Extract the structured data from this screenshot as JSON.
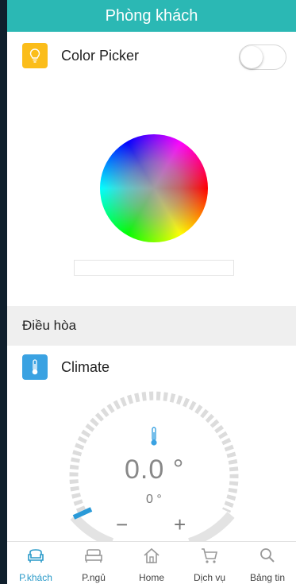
{
  "header": {
    "title": "Phòng khách"
  },
  "color_picker": {
    "label": "Color Picker",
    "icon": "lightbulb-icon",
    "toggle_on": false,
    "accent": "#fbbd1a"
  },
  "section": {
    "title": "Điều hòa"
  },
  "climate": {
    "label": "Climate",
    "icon": "thermometer-icon",
    "accent": "#3aa2e2",
    "temperature": "0.0 °",
    "secondary_temperature": "0 °",
    "minus": "−",
    "plus": "+"
  },
  "tabs": [
    {
      "label": "P.khách",
      "icon": "sofa-icon",
      "active": true
    },
    {
      "label": "P.ngủ",
      "icon": "bed-icon",
      "active": false
    },
    {
      "label": "Home",
      "icon": "home-icon",
      "active": false
    },
    {
      "label": "Dịch vụ",
      "icon": "cart-icon",
      "active": false
    },
    {
      "label": "Bảng tin",
      "icon": "search-icon",
      "active": false
    }
  ],
  "colors": {
    "header": "#2bb8b4",
    "active_tab": "#2a9ac9"
  }
}
